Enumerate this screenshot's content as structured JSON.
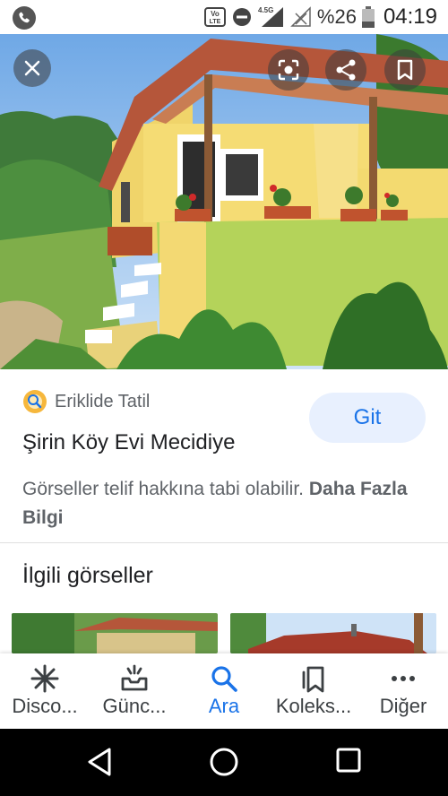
{
  "status_bar": {
    "battery_text": "%26",
    "time": "04:19",
    "network_label": "4.5G",
    "volte_label": "Vo LTE"
  },
  "image_viewer": {
    "close_icon": "close-icon",
    "lens_icon": "google-lens-icon",
    "share_icon": "share-icon",
    "save_icon": "bookmark-icon"
  },
  "result": {
    "source_name": "Eriklide Tatil",
    "title": "Şirin Köy Evi Mecidiye",
    "visit_label": "Git",
    "copyright_text": "Görseller telif hakkına tabi olabilir.",
    "more_info_label": "Daha Fazla Bilgi"
  },
  "related": {
    "heading": "İlgili görseller"
  },
  "bottom_nav": {
    "items": [
      {
        "label": "Disco...",
        "icon": "discover-asterisk-icon"
      },
      {
        "label": "Günc...",
        "icon": "updates-inbox-icon"
      },
      {
        "label": "Ara",
        "icon": "search-icon"
      },
      {
        "label": "Koleks...",
        "icon": "collections-icon"
      },
      {
        "label": "Diğer",
        "icon": "more-dots-icon"
      }
    ],
    "active_index": 2
  },
  "colors": {
    "accent": "#1a73e8",
    "visit_button_bg": "#e8f0fe",
    "house_wall": "#f2d76a",
    "roof": "#b55a3c"
  }
}
